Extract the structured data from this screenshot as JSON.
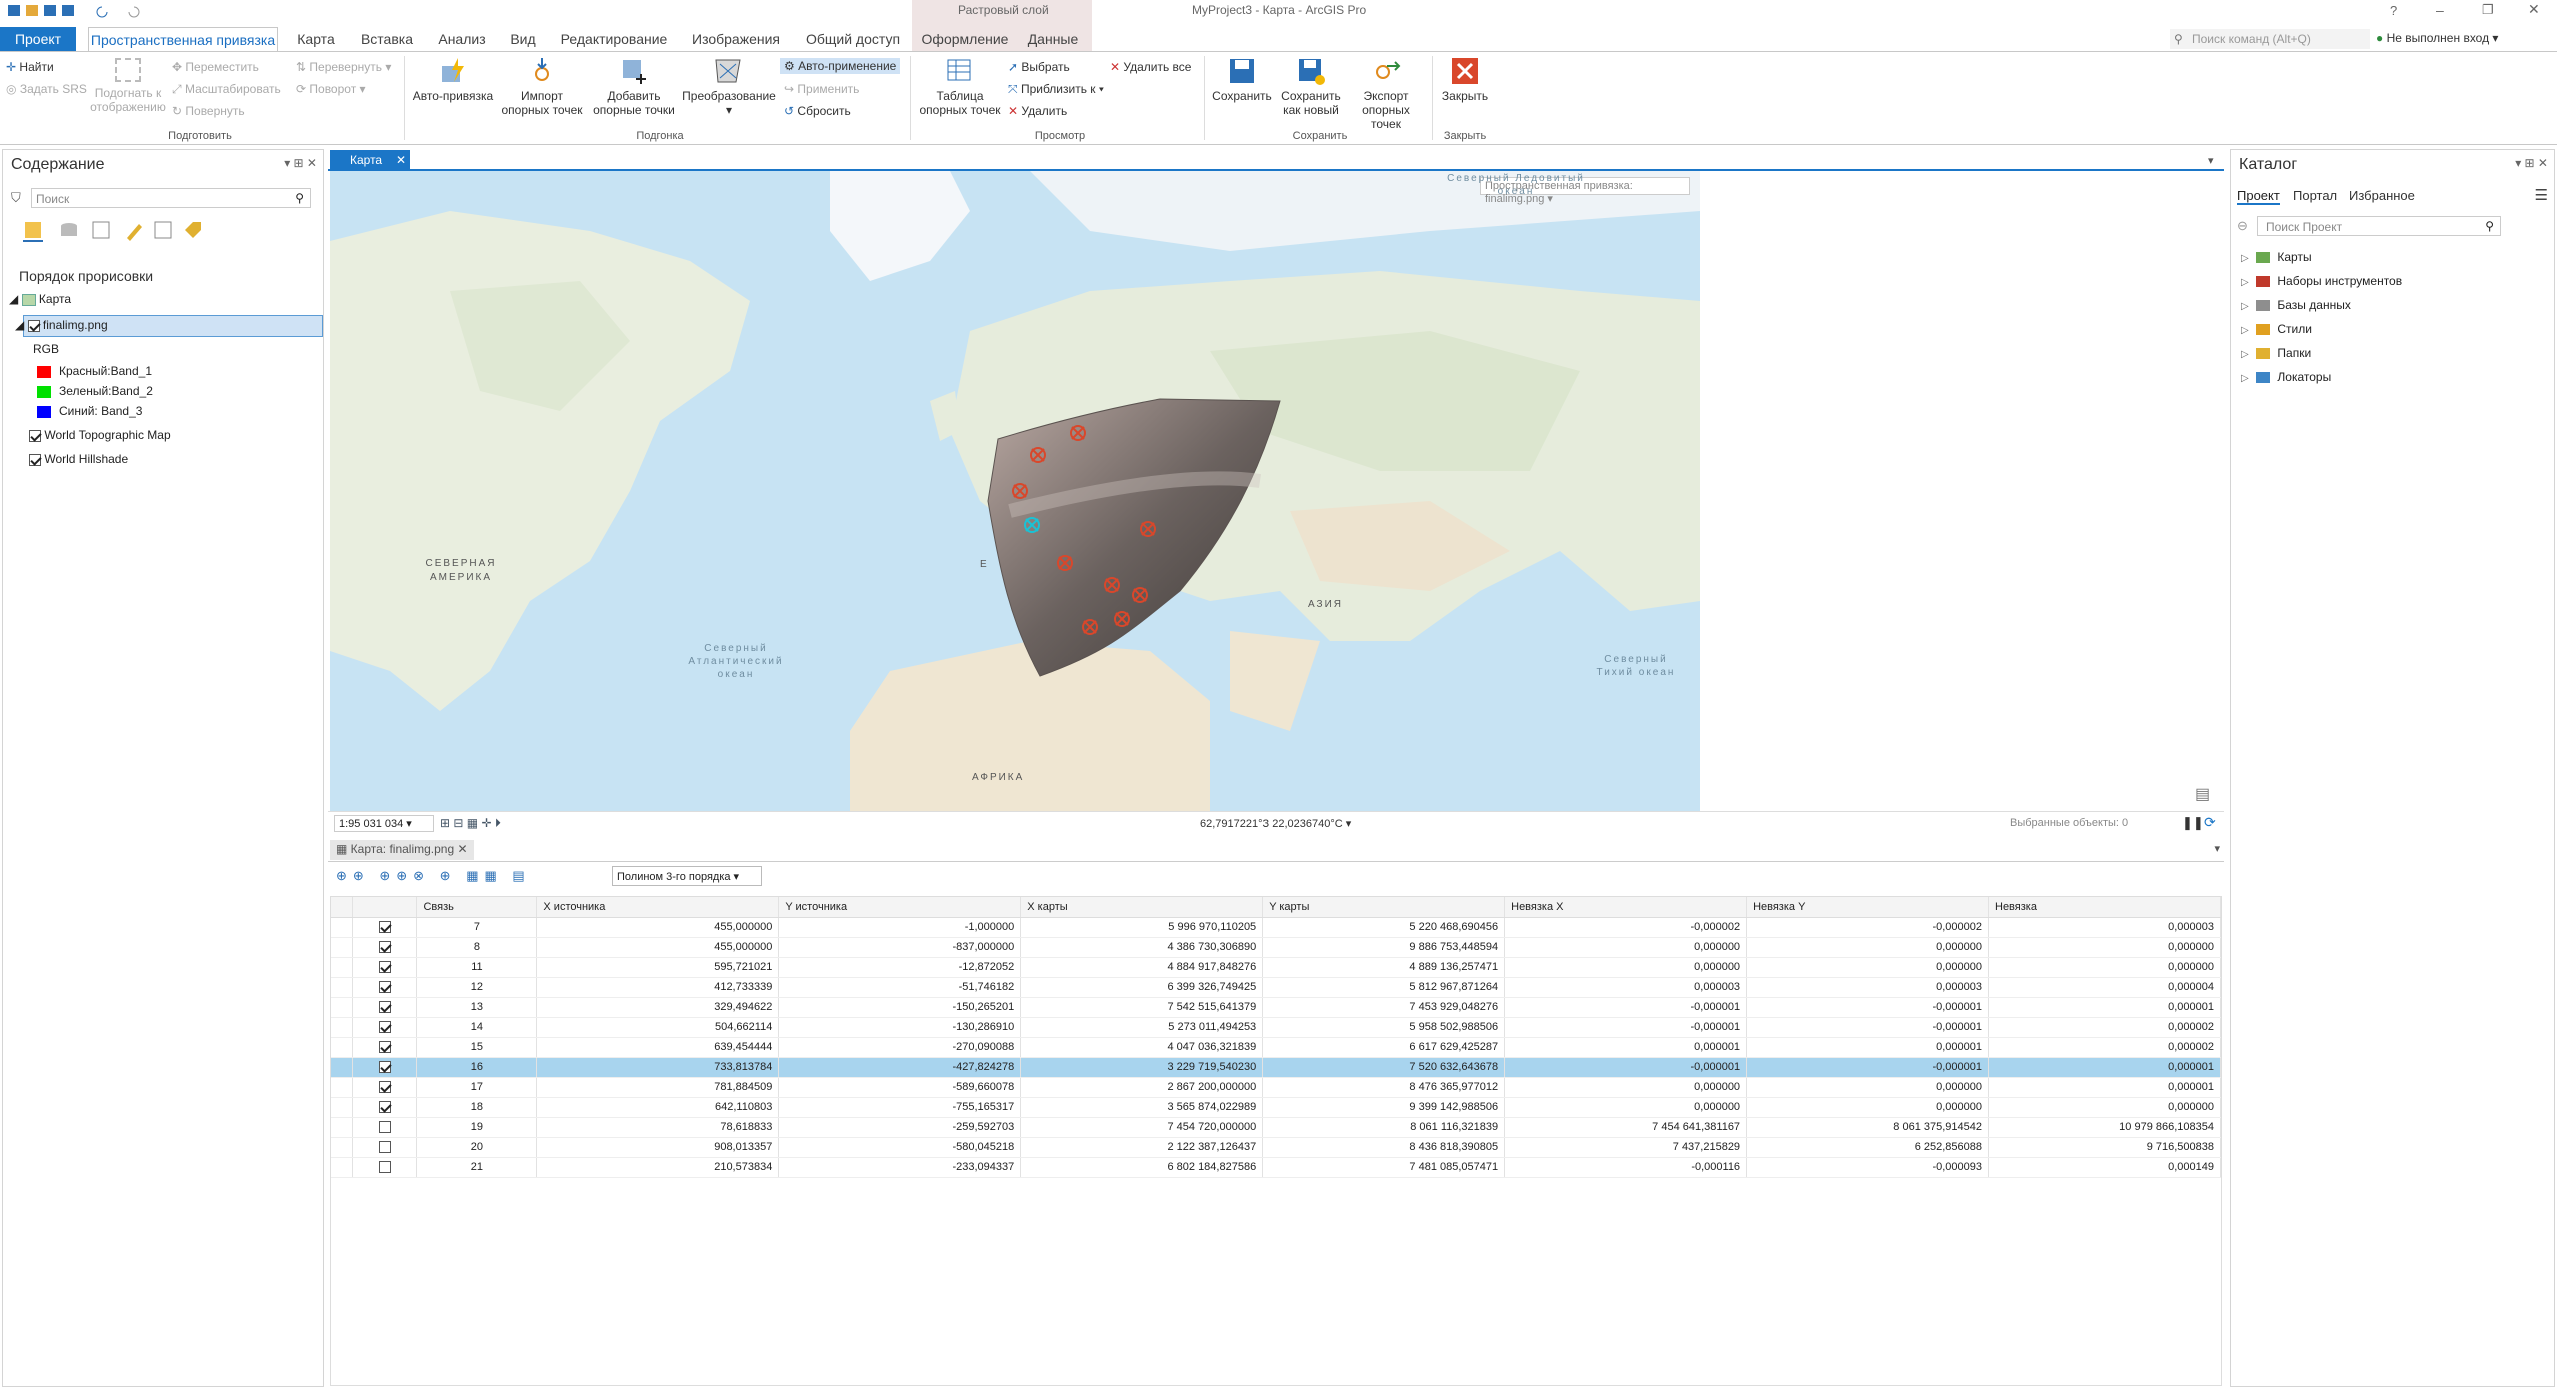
{
  "titlebar": {
    "context_tab": "Растровый слой",
    "title": "MyProject3 - Карта - ArcGIS Pro",
    "help": "?"
  },
  "tabs": {
    "project": "Проект",
    "georef": "Пространственная привязка",
    "map": "Карта",
    "insert": "Вставка",
    "analysis": "Анализ",
    "view": "Вид",
    "edit": "Редактирование",
    "imagery": "Изображения",
    "share": "Общий доступ",
    "appearance": "Оформление",
    "data": "Данные"
  },
  "search": {
    "placeholder": "Поиск команд (Alt+Q)",
    "signin": "Не выполнен вход"
  },
  "ribbon": {
    "find": "Найти",
    "set_srs": "Задать SRS",
    "fit": "Подогнать к отображению",
    "move": "Переместить",
    "scale": "Масштабировать",
    "rotate": "Повернуть",
    "flip": "Перевернуть",
    "turn": "Поворот",
    "group_prepare": "Подготовить",
    "auto": "Авто-привязка",
    "import": "Импорт опорных точек",
    "add": "Добавить опорные точки",
    "transform": "Преобразование",
    "auto_apply": "Авто-применение",
    "apply": "Применить",
    "reset": "Сбросить",
    "group_fit": "Подгонка",
    "table": "Таблица опорных точек",
    "select": "Выбрать",
    "zoom_to": "Приблизить к",
    "delete": "Удалить",
    "delete_all": "Удалить все",
    "group_view": "Просмотр",
    "save": "Сохранить",
    "save_as": "Сохранить как новый",
    "export": "Экспорт опорных точек",
    "group_save": "Сохранить",
    "close": "Закрыть",
    "group_close": "Закрыть"
  },
  "contents": {
    "title": "Содержание",
    "search_placeholder": "Поиск",
    "draw_order": "Порядок прорисовки",
    "map": "Карта",
    "layer": "finalimg.png",
    "rgb": "RGB",
    "red": "Красный:Band_1",
    "green": "Зеленый:Band_2",
    "blue": "Синий: Band_3",
    "topo": "World Topographic Map",
    "hillshade": "World Hillshade",
    "colors": {
      "red": "#ff0000",
      "green": "#00e000",
      "blue": "#0000ff"
    }
  },
  "map": {
    "tab": "Карта",
    "georef_dropdown": "Пространственная привязка: finalimg.png",
    "labels": {
      "arctic": "Северный Ледовитый океан",
      "na": "СЕВЕРНАЯ АМЕРИКА",
      "atlantic": "Северный Атлантический океан",
      "asia": "АЗИЯ",
      "pacific": "Северный Тихий океан",
      "africa": "АФРИКА",
      "eu": "Е"
    },
    "scale": "1:95 031 034",
    "coords": "62,7917221°З 22,0236740°С",
    "selected": "Выбранные объекты: 0"
  },
  "table": {
    "tab": "Карта: finalimg.png",
    "transform": "Полином 3-го порядка",
    "headers": [
      "Связь",
      "X источника",
      "Y источника",
      "X карты",
      "Y карты",
      "Невязка X",
      "Невязка Y",
      "Невязка"
    ],
    "rows": [
      {
        "c": true,
        "id": "7",
        "xs": "455,000000",
        "ys": "-1,000000",
        "xm": "5 996 970,110205",
        "ym": "5 220 468,690456",
        "rx": "-0,000002",
        "ry": "-0,000002",
        "r": "0,000003"
      },
      {
        "c": true,
        "id": "8",
        "xs": "455,000000",
        "ys": "-837,000000",
        "xm": "4 386 730,306890",
        "ym": "9 886 753,448594",
        "rx": "0,000000",
        "ry": "0,000000",
        "r": "0,000000"
      },
      {
        "c": true,
        "id": "11",
        "xs": "595,721021",
        "ys": "-12,872052",
        "xm": "4 884 917,848276",
        "ym": "4 889 136,257471",
        "rx": "0,000000",
        "ry": "0,000000",
        "r": "0,000000"
      },
      {
        "c": true,
        "id": "12",
        "xs": "412,733339",
        "ys": "-51,746182",
        "xm": "6 399 326,749425",
        "ym": "5 812 967,871264",
        "rx": "0,000003",
        "ry": "0,000003",
        "r": "0,000004"
      },
      {
        "c": true,
        "id": "13",
        "xs": "329,494622",
        "ys": "-150,265201",
        "xm": "7 542 515,641379",
        "ym": "7 453 929,048276",
        "rx": "-0,000001",
        "ry": "-0,000001",
        "r": "0,000001"
      },
      {
        "c": true,
        "id": "14",
        "xs": "504,662114",
        "ys": "-130,286910",
        "xm": "5 273 011,494253",
        "ym": "5 958 502,988506",
        "rx": "-0,000001",
        "ry": "-0,000001",
        "r": "0,000002"
      },
      {
        "c": true,
        "id": "15",
        "xs": "639,454444",
        "ys": "-270,090088",
        "xm": "4 047 036,321839",
        "ym": "6 617 629,425287",
        "rx": "0,000001",
        "ry": "0,000001",
        "r": "0,000002"
      },
      {
        "c": true,
        "id": "16",
        "xs": "733,813784",
        "ys": "-427,824278",
        "xm": "3 229 719,540230",
        "ym": "7 520 632,643678",
        "rx": "-0,000001",
        "ry": "-0,000001",
        "r": "0,000001",
        "sel": true
      },
      {
        "c": true,
        "id": "17",
        "xs": "781,884509",
        "ys": "-589,660078",
        "xm": "2 867 200,000000",
        "ym": "8 476 365,977012",
        "rx": "0,000000",
        "ry": "0,000000",
        "r": "0,000001"
      },
      {
        "c": true,
        "id": "18",
        "xs": "642,110803",
        "ys": "-755,165317",
        "xm": "3 565 874,022989",
        "ym": "9 399 142,988506",
        "rx": "0,000000",
        "ry": "0,000000",
        "r": "0,000000"
      },
      {
        "c": false,
        "id": "19",
        "xs": "78,618833",
        "ys": "-259,592703",
        "xm": "7 454 720,000000",
        "ym": "8 061 116,321839",
        "rx": "7 454 641,381167",
        "ry": "8 061 375,914542",
        "r": "10 979 866,108354"
      },
      {
        "c": false,
        "id": "20",
        "xs": "908,013357",
        "ys": "-580,045218",
        "xm": "2 122 387,126437",
        "ym": "8 436 818,390805",
        "rx": "7 437,215829",
        "ry": "6 252,856088",
        "r": "9 716,500838"
      },
      {
        "c": false,
        "id": "21",
        "xs": "210,573834",
        "ys": "-233,094337",
        "xm": "6 802 184,827586",
        "ym": "7 481 085,057471",
        "rx": "-0,000116",
        "ry": "-0,000093",
        "r": "0,000149"
      }
    ]
  },
  "catalog": {
    "title": "Каталог",
    "tab_project": "Проект",
    "tab_portal": "Портал",
    "tab_fav": "Избранное",
    "search_placeholder": "Поиск Проект",
    "items": [
      "Карты",
      "Наборы инструментов",
      "Базы данных",
      "Стили",
      "Папки",
      "Локаторы"
    ]
  }
}
